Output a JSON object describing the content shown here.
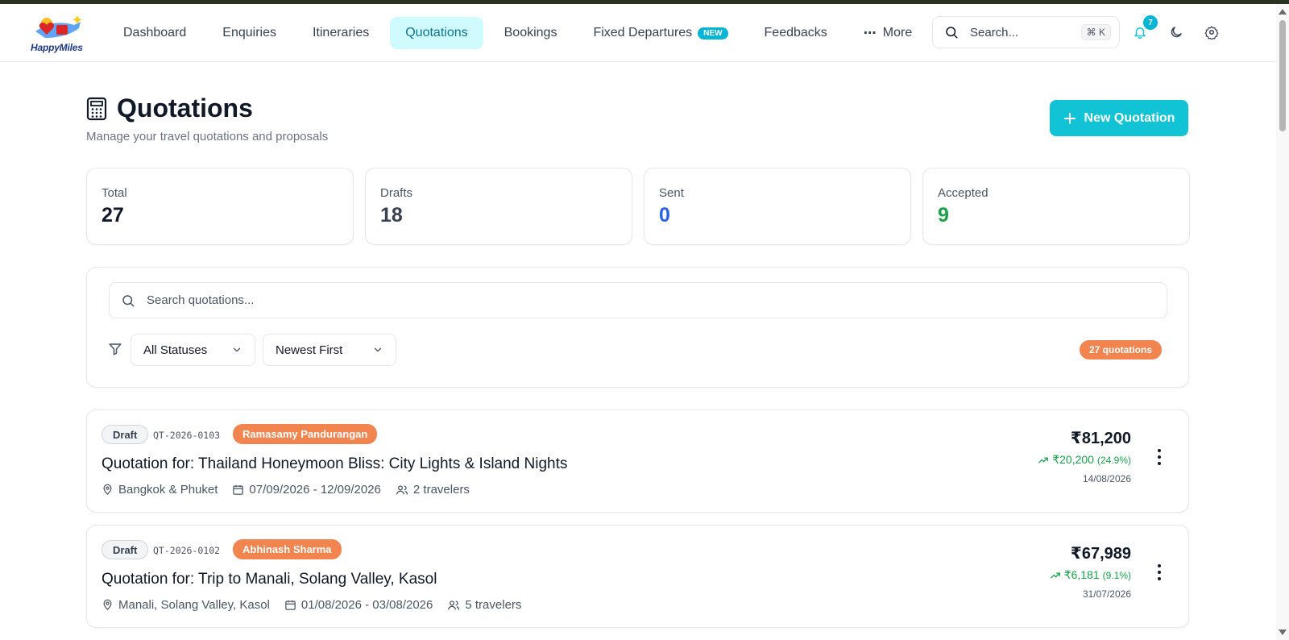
{
  "brand": {
    "name": "HappyMiles"
  },
  "nav": {
    "items": [
      "Dashboard",
      "Enquiries",
      "Itineraries",
      "Quotations",
      "Bookings",
      "Fixed Departures",
      "Feedbacks",
      "More"
    ],
    "active": "Quotations",
    "new_badge": "NEW"
  },
  "header": {
    "search_placeholder": "Search...",
    "shortcut": "⌘ K",
    "notifications": "7"
  },
  "page": {
    "title": "Quotations",
    "subtitle": "Manage your travel quotations and proposals",
    "new_button": "New Quotation"
  },
  "stats": [
    {
      "label": "Total",
      "value": "27",
      "color": "#111827"
    },
    {
      "label": "Drafts",
      "value": "18",
      "color": "#374151"
    },
    {
      "label": "Sent",
      "value": "0",
      "color": "#2563eb"
    },
    {
      "label": "Accepted",
      "value": "9",
      "color": "#16a34a"
    }
  ],
  "filters": {
    "search_placeholder": "Search quotations...",
    "status_select": "All Statuses",
    "sort_select": "Newest First",
    "count_label": "27 quotations"
  },
  "quotations": [
    {
      "status": "Draft",
      "code": "QT-2026-0103",
      "client": "Ramasamy Pandurangan",
      "title": "Quotation for: Thailand Honeymoon Bliss: City Lights & Island Nights",
      "location": "Bangkok & Phuket",
      "dates": "07/09/2026 - 12/09/2026",
      "travelers": "2 travelers",
      "price": "₹81,200",
      "margin": "₹20,200",
      "margin_pct": "(24.9%)",
      "date": "14/08/2026"
    },
    {
      "status": "Draft",
      "code": "QT-2026-0102",
      "client": "Abhinash Sharma",
      "title": "Quotation for: Trip to Manali, Solang Valley, Kasol",
      "location": "Manali, Solang Valley, Kasol",
      "dates": "01/08/2026 - 03/08/2026",
      "travelers": "5 travelers",
      "price": "₹67,989",
      "margin": "₹6,181",
      "margin_pct": "(9.1%)",
      "date": "31/07/2026"
    }
  ],
  "colors": {
    "accent": "#12c3d6",
    "client_badge": "#f2844f",
    "positive": "#16a34a"
  }
}
